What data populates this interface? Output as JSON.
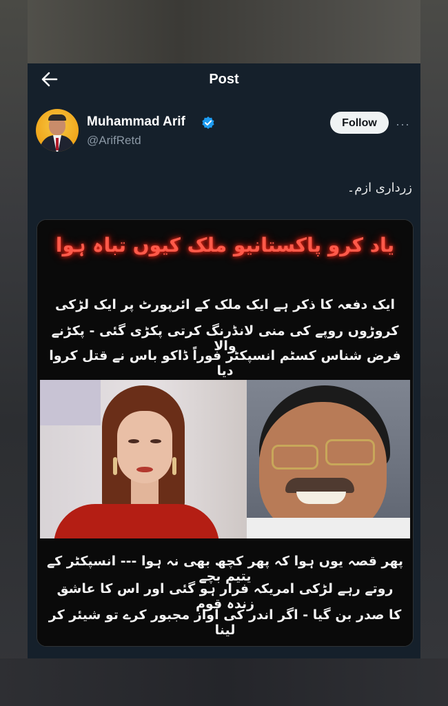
{
  "header": {
    "title": "Post",
    "back_icon": "arrow-left-icon"
  },
  "author": {
    "name": "Muhammad Arif",
    "handle": "@ArifRetd",
    "verified": true,
    "verified_color": "#1d9bf0"
  },
  "actions": {
    "follow_label": "Follow",
    "more_label": "···"
  },
  "post": {
    "text": "زرداری ازم۔",
    "image": {
      "headline": "یاد کرو پاکستانیو ملک کیوں تباہ ہوا",
      "top_lines": [
        "ایک دفعہ کا ذکر ہے ایک ملک کے ائرپورٹ پر ایک لڑکی",
        "کروڑوں روپے کی منی لانڈرنگ کرتی پکڑی گئی - پکڑنے والا",
        "فرض شناس کسٹم انسپکٹر فوراً ڈاکو باس نے قتل کروا دیا"
      ],
      "bottom_lines": [
        "پھر قصہ یوں ہوا کہ پھر کچھ بھی نہ ہوا --- انسپکٹر کے یتیم بچے",
        "روتے رہے لڑکی امریکہ فرار ہو گئی اور اس کا عاشق زندہ قوم",
        "کا صدر بن گیا - اگر اندر کی آواز مجبور کرے تو شیئر کر لینا"
      ]
    }
  },
  "colors": {
    "card_bg": "#15202b",
    "text": "#e7e9ea",
    "muted": "#8b98a5",
    "headline": "#ff5a4a"
  }
}
